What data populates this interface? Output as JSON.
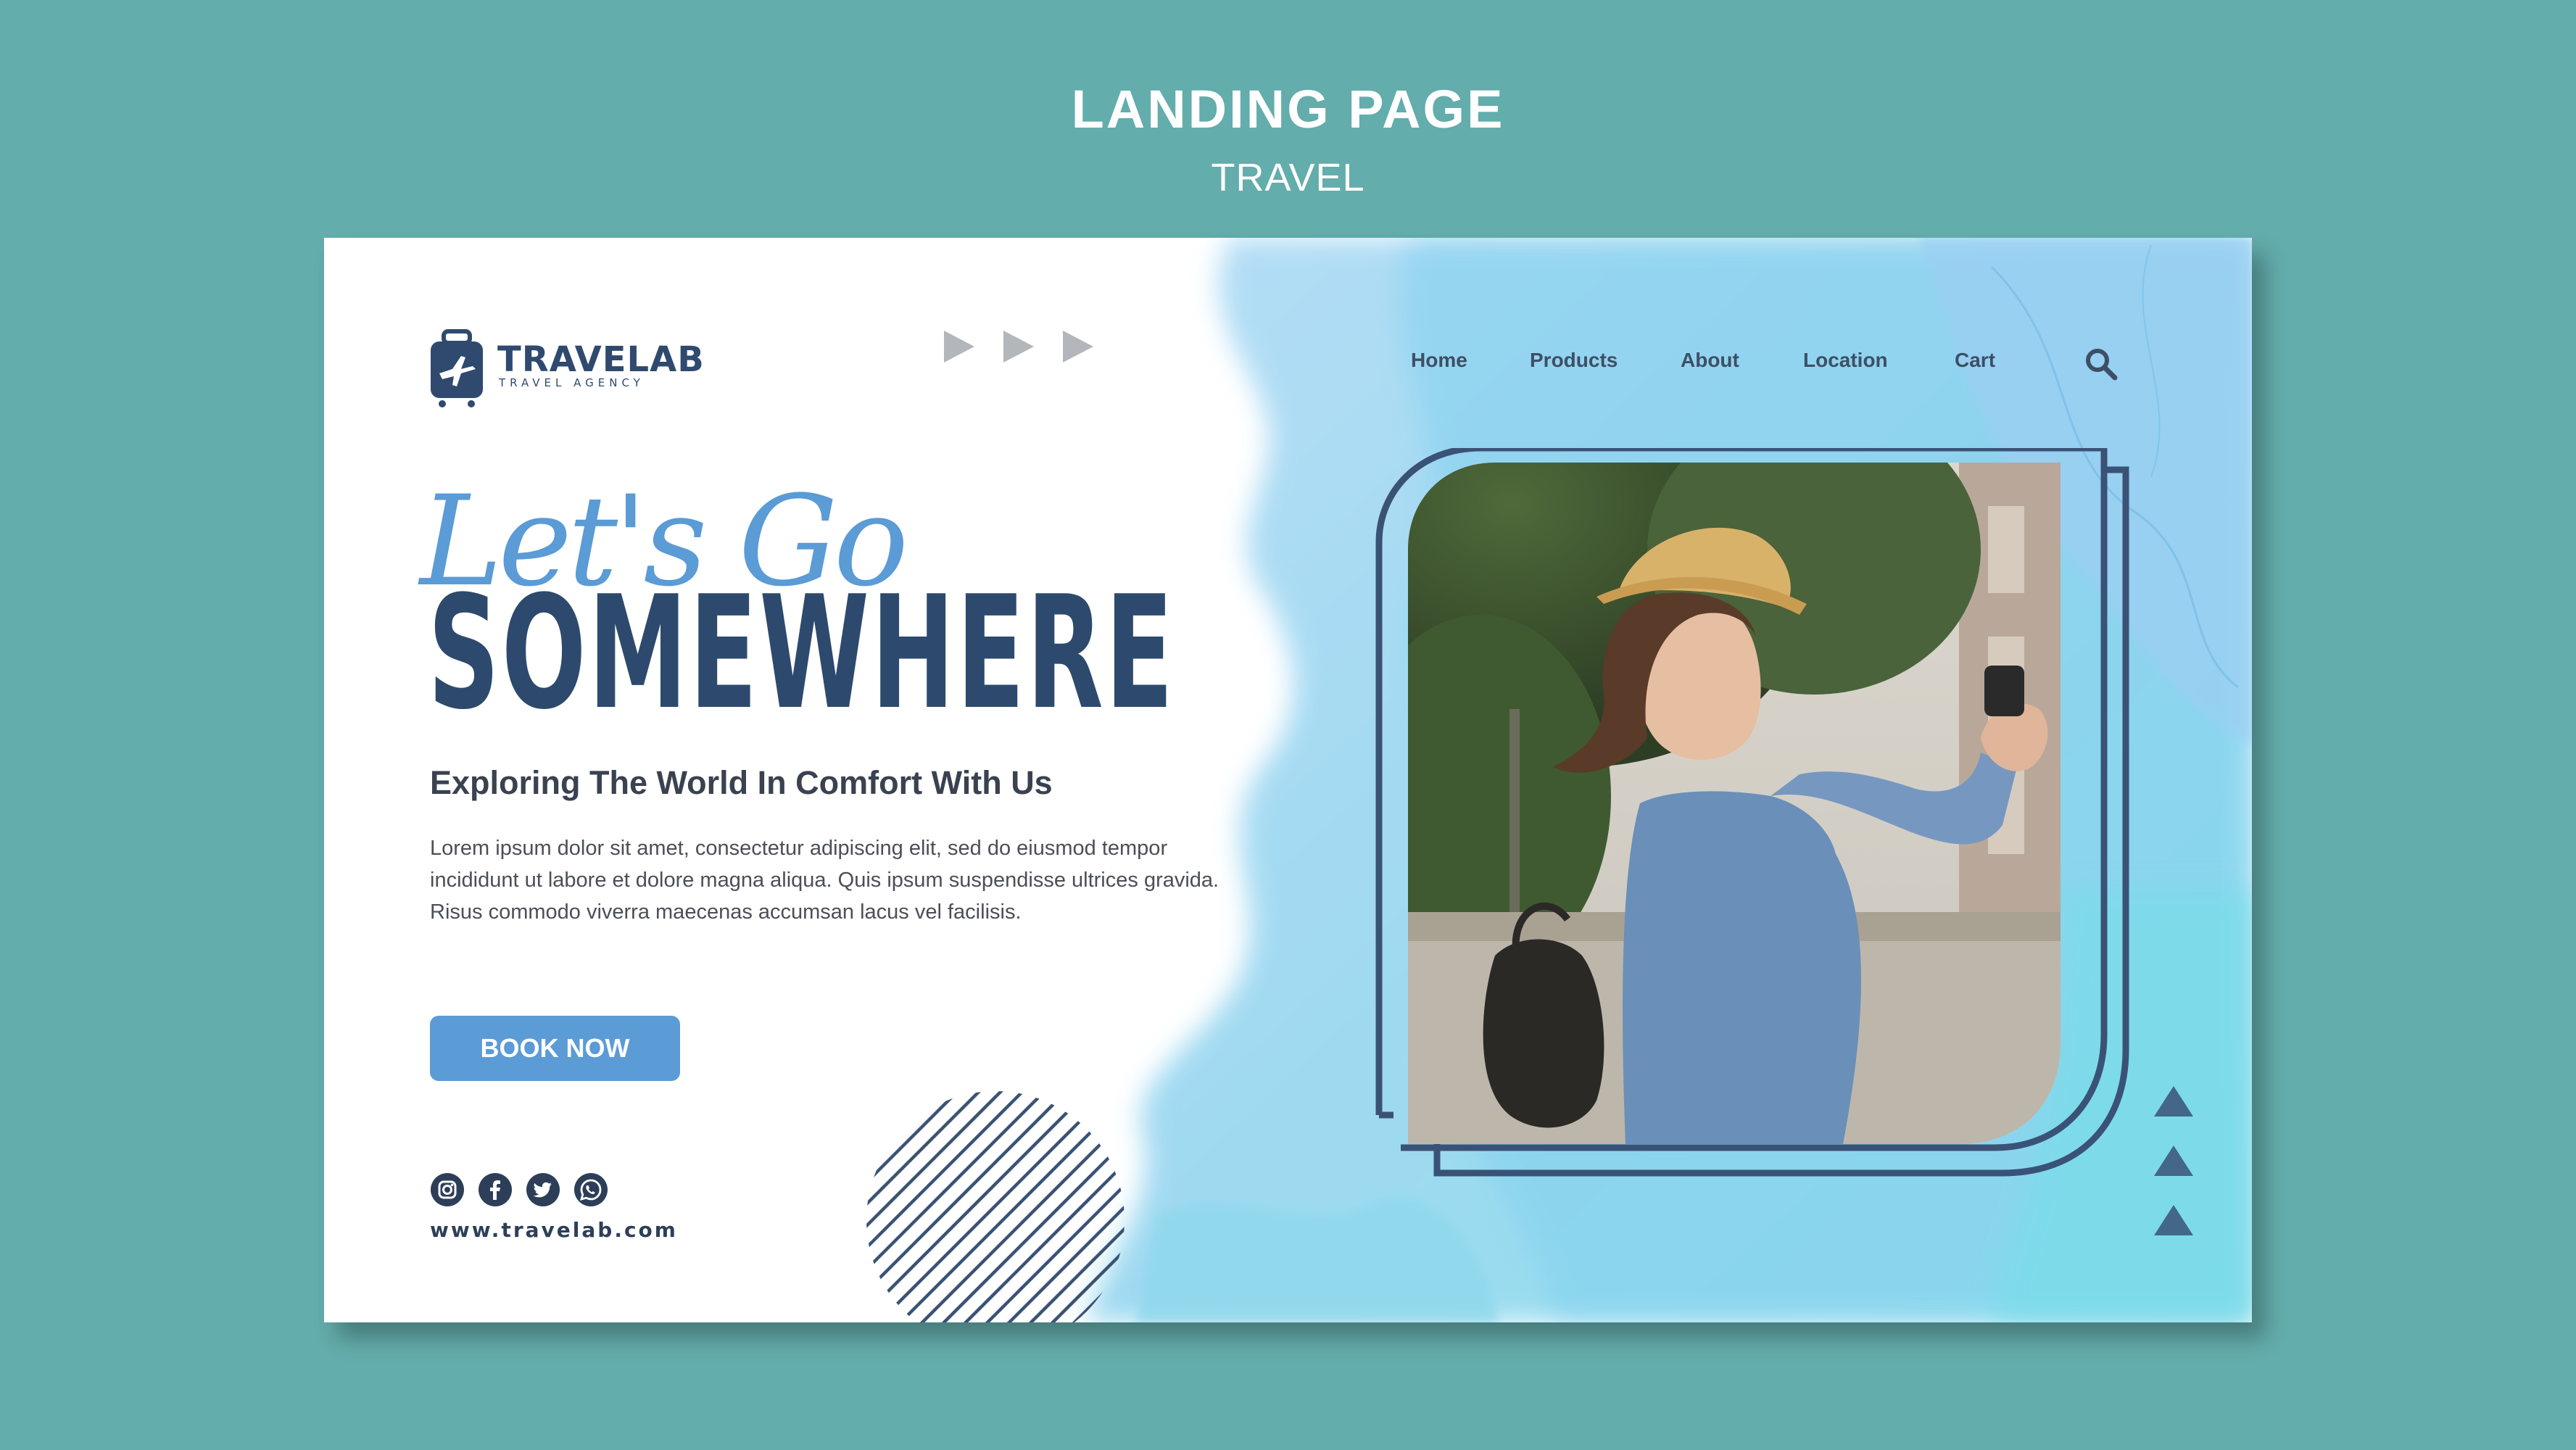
{
  "caption": {
    "title": "LANDING PAGE",
    "subtitle": "TRAVEL"
  },
  "logo": {
    "name": "TRAVELAB",
    "tagline": "TRAVEL AGENCY"
  },
  "nav": {
    "items": [
      {
        "label": "Home"
      },
      {
        "label": "Products"
      },
      {
        "label": "About"
      },
      {
        "label": "Location"
      },
      {
        "label": "Cart"
      }
    ]
  },
  "hero": {
    "script": "Let's Go",
    "headline": "SOMEWHERE",
    "subheading": "Exploring The World In Comfort With Us",
    "body": "Lorem ipsum dolor sit amet, consectetur adipiscing elit, sed do eiusmod tempor incididunt ut labore et dolore magna aliqua. Quis ipsum suspendisse ultrices gravida. Risus commodo viverra maecenas accumsan lacus vel facilisis.",
    "cta": "BOOK NOW"
  },
  "footer": {
    "social_icons": [
      "instagram-icon",
      "facebook-icon",
      "twitter-icon",
      "whatsapp-icon"
    ],
    "website": "www.travelab.com"
  },
  "colors": {
    "page_background": "#63adac",
    "navy": "#2d4a6e",
    "accent_blue": "#5b9bd6",
    "frame_navy": "#3a5275",
    "watercolor": "#8fd3ef"
  }
}
